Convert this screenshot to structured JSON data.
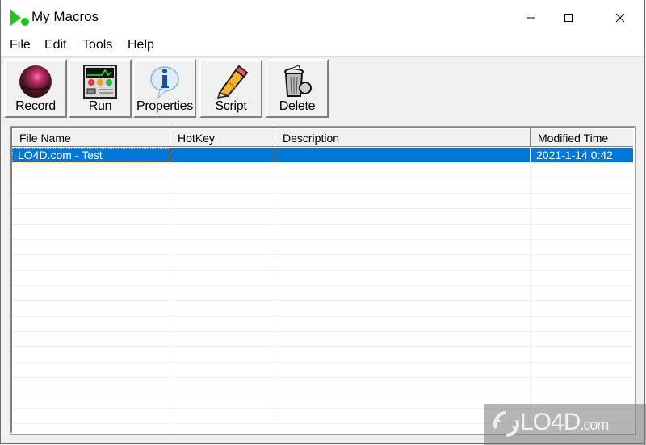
{
  "window": {
    "title": "My Macros",
    "controls": {
      "minimize": "minimize-icon",
      "maximize": "maximize-icon",
      "close": "close-icon"
    }
  },
  "menu": [
    "File",
    "Edit",
    "Tools",
    "Help"
  ],
  "toolbar": {
    "buttons": [
      {
        "label": "Record",
        "icon": "record-ball-icon"
      },
      {
        "label": "Run",
        "icon": "run-panel-icon"
      },
      {
        "label": "Properties",
        "icon": "info-bubble-icon"
      },
      {
        "label": "Script",
        "icon": "pencil-icon"
      },
      {
        "label": "Delete",
        "icon": "trash-can-icon"
      }
    ]
  },
  "table": {
    "columns": [
      "File Name",
      "HotKey",
      "Description",
      "Modified Time"
    ],
    "rows": [
      {
        "file_name": "LO4D.com - Test",
        "hotkey": "",
        "description": "",
        "modified_time": "2021-1-14 0:42",
        "selected": true
      }
    ]
  },
  "colors": {
    "selection": "#0078d7",
    "app_icon": "#1ec71e"
  },
  "watermark": {
    "brand": "LO4D",
    "suffix": ".com"
  }
}
